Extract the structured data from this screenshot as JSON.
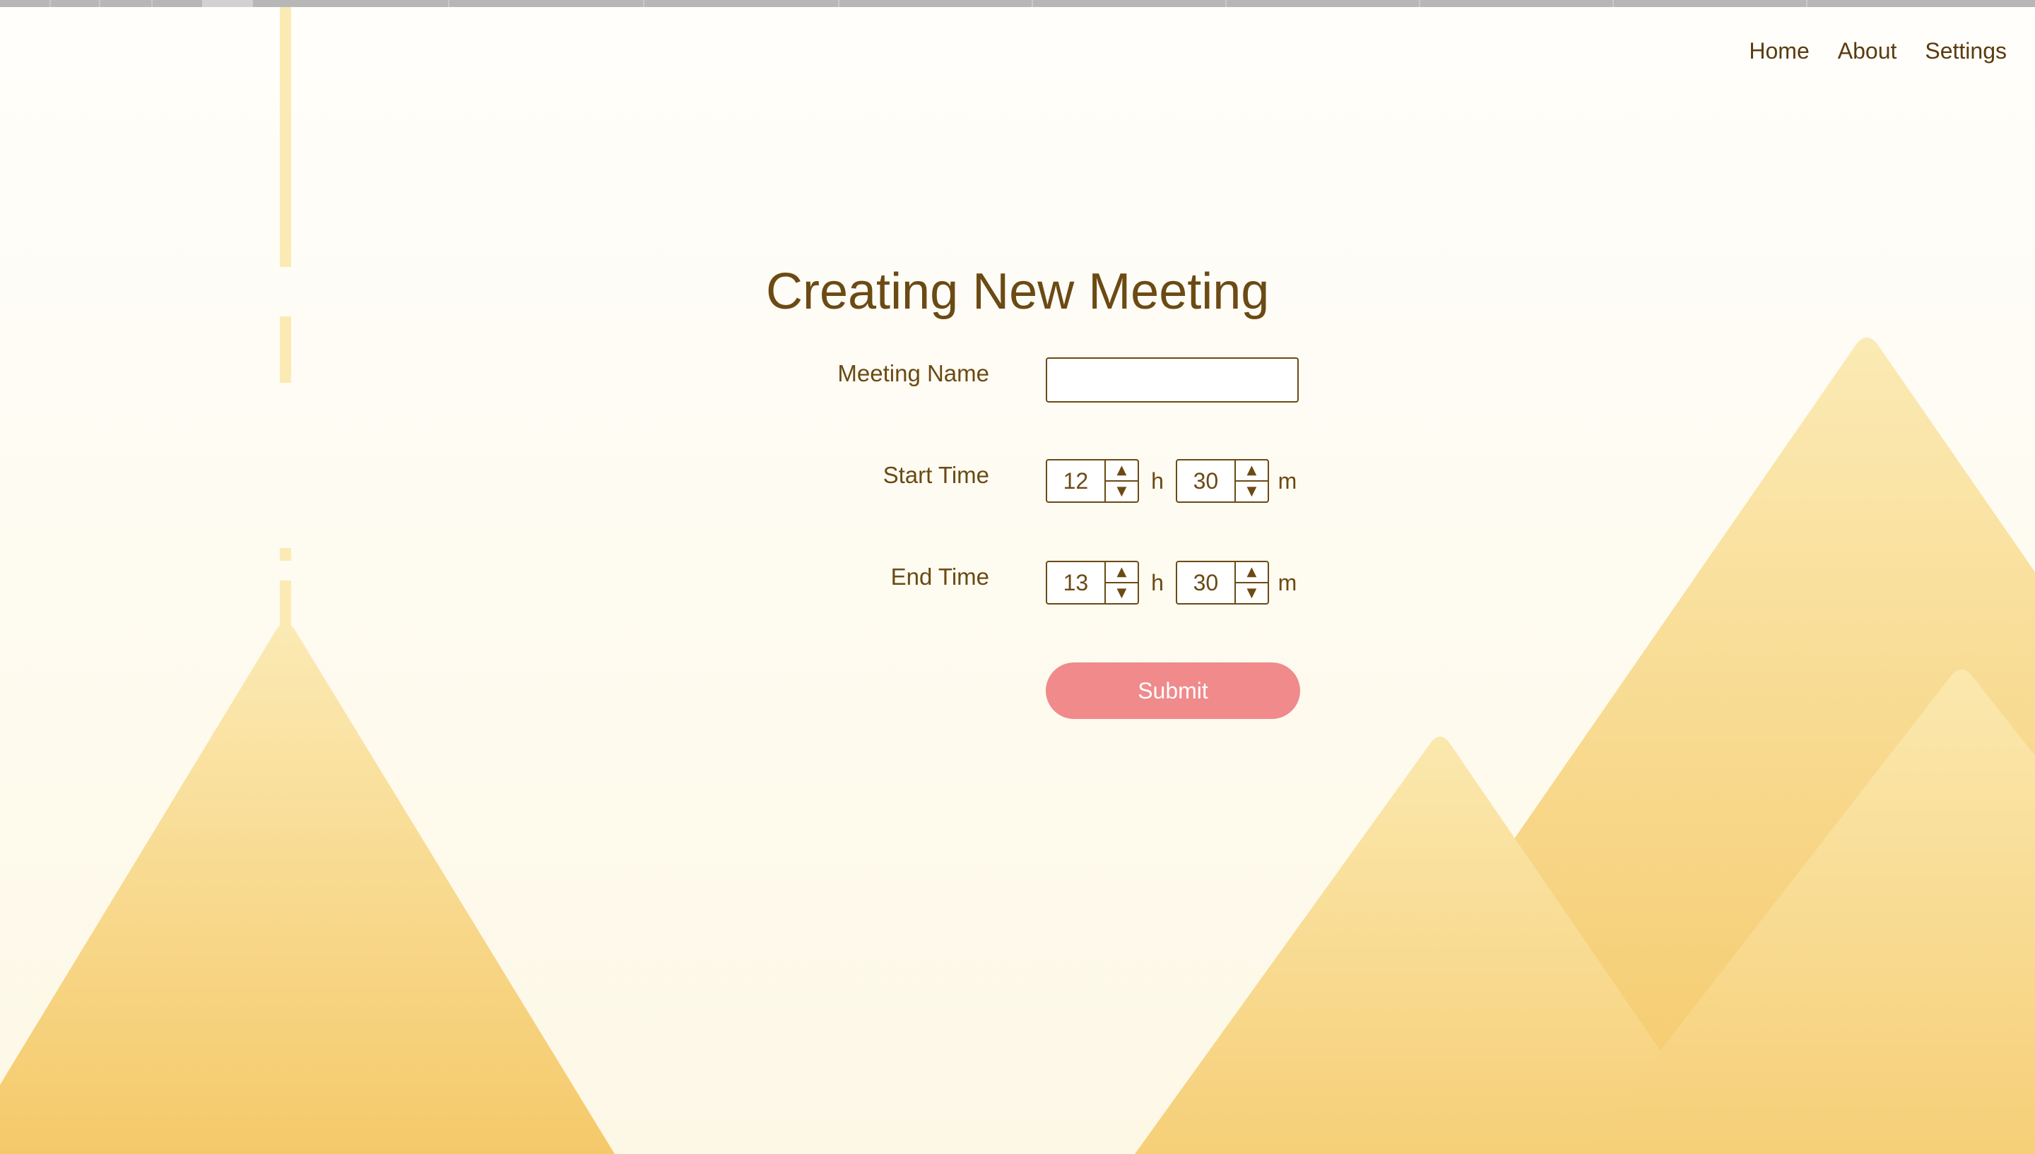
{
  "nav": {
    "items": [
      {
        "label": "Home"
      },
      {
        "label": "About"
      },
      {
        "label": "Settings"
      }
    ]
  },
  "form": {
    "title": "Creating New Meeting",
    "meeting_name": {
      "label": "Meeting Name",
      "value": "",
      "placeholder": ""
    },
    "start_time": {
      "label": "Start Time",
      "hours": "12",
      "minutes": "30",
      "hour_unit": "h",
      "minute_unit": "m"
    },
    "end_time": {
      "label": "End Time",
      "hours": "13",
      "minutes": "30",
      "hour_unit": "h",
      "minute_unit": "m"
    },
    "submit_label": "Submit"
  },
  "colors": {
    "text": "#6b4a14",
    "accent_button": "#f08a8b",
    "mountain_light": "#fbe8ae",
    "mountain_dark": "#f5c96a",
    "background": "#fffdf6"
  },
  "icons": {
    "up_arrow": "triangle-up",
    "down_arrow": "triangle-down"
  }
}
